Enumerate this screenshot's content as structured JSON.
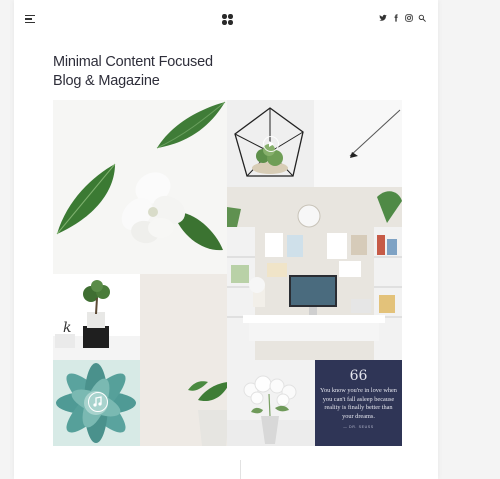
{
  "header": {
    "menu_icon": "hamburger-icon",
    "logo_icon": "four-dots-logo",
    "social_icons": [
      "twitter-icon",
      "facebook-icon",
      "instagram-icon",
      "search-icon"
    ]
  },
  "hero": {
    "title_line1": "Minimal Content Focused",
    "title_line2": "Blog & Magazine"
  },
  "tiles": [
    {
      "name": "flower-leaves-photo"
    },
    {
      "name": "geometric-terrarium-photo"
    },
    {
      "name": "white-pen-photo"
    },
    {
      "name": "home-office-shelves-photo"
    },
    {
      "name": "bonsai-candle-photo"
    },
    {
      "name": "beige-wall-photo"
    },
    {
      "name": "succulent-photo"
    },
    {
      "name": "potted-plant-photo"
    },
    {
      "name": "white-flowers-vase-photo"
    }
  ],
  "quote": {
    "mark": "66",
    "text": "You know you're in love when you can't fall asleep because reality is finally better than your dreams.",
    "author": "— DR. SEUSS"
  },
  "colors": {
    "quote_bg": "#2f3556",
    "accent_green": "#3e7d3a",
    "page_bg": "#ffffff"
  }
}
